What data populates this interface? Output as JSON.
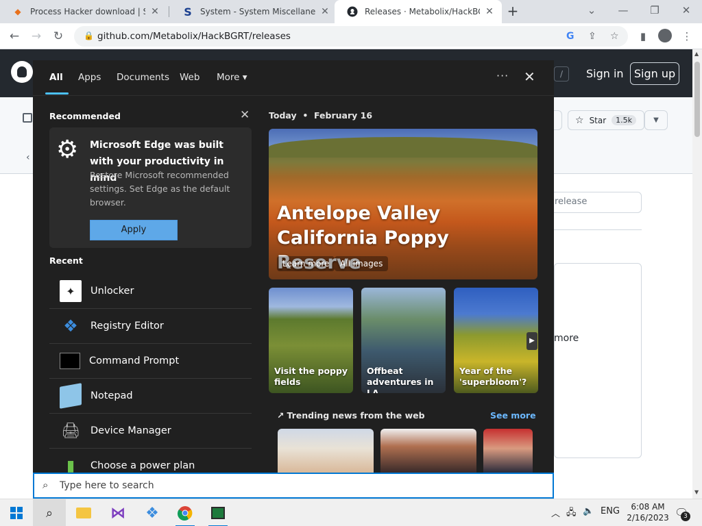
{
  "browser": {
    "tabs": [
      {
        "title": "Process Hacker download | Sourc",
        "icon": "process-hacker-icon"
      },
      {
        "title": "System - System Miscellaneous (",
        "icon": "systems-icon"
      },
      {
        "title": "Releases · Metabolix/HackBGRT",
        "icon": "github-icon"
      }
    ],
    "url": "github.com/Metabolix/HackBGRT/releases"
  },
  "github": {
    "sign_in": "Sign in",
    "sign_up": "Sign up",
    "slash_key": "/",
    "star_label": "Star",
    "star_count": "1.5k",
    "search_placeholder_fragment": "release",
    "more_fragment": "more"
  },
  "flyout": {
    "tabs": [
      "All",
      "Apps",
      "Documents",
      "Web",
      "More ▾"
    ],
    "recommended": {
      "title": "Recommended",
      "heading": "Microsoft Edge was built with your productivity in mind",
      "body": "Restore Microsoft recommended settings. Set Edge as the default browser.",
      "apply_label": "Apply"
    },
    "recent": {
      "title": "Recent",
      "items": [
        {
          "label": "Unlocker",
          "icon": "unlocker-icon"
        },
        {
          "label": "Registry Editor",
          "icon": "registry-editor-icon"
        },
        {
          "label": "Command Prompt",
          "icon": "command-prompt-icon"
        },
        {
          "label": "Notepad",
          "icon": "notepad-icon"
        },
        {
          "label": "Device Manager",
          "icon": "device-manager-icon"
        },
        {
          "label": "Choose a power plan",
          "icon": "power-plan-icon"
        }
      ]
    },
    "today": {
      "label": "Today",
      "date": "February 16",
      "hero_title": "Antelope Valley California Poppy Reserve",
      "learn_more": "Learn more",
      "all_images": "All images"
    },
    "tiles": [
      {
        "label": "Visit the poppy fields"
      },
      {
        "label": "Offbeat adventures in LA"
      },
      {
        "label": "Year of the 'superbloom'?"
      }
    ],
    "trending": {
      "title": "Trending news from the web",
      "see_more": "See more"
    }
  },
  "search": {
    "placeholder": "Type here to search"
  },
  "taskbar": {
    "language": "ENG",
    "time": "6:08 AM",
    "date": "2/16/2023",
    "notifications": "3"
  }
}
